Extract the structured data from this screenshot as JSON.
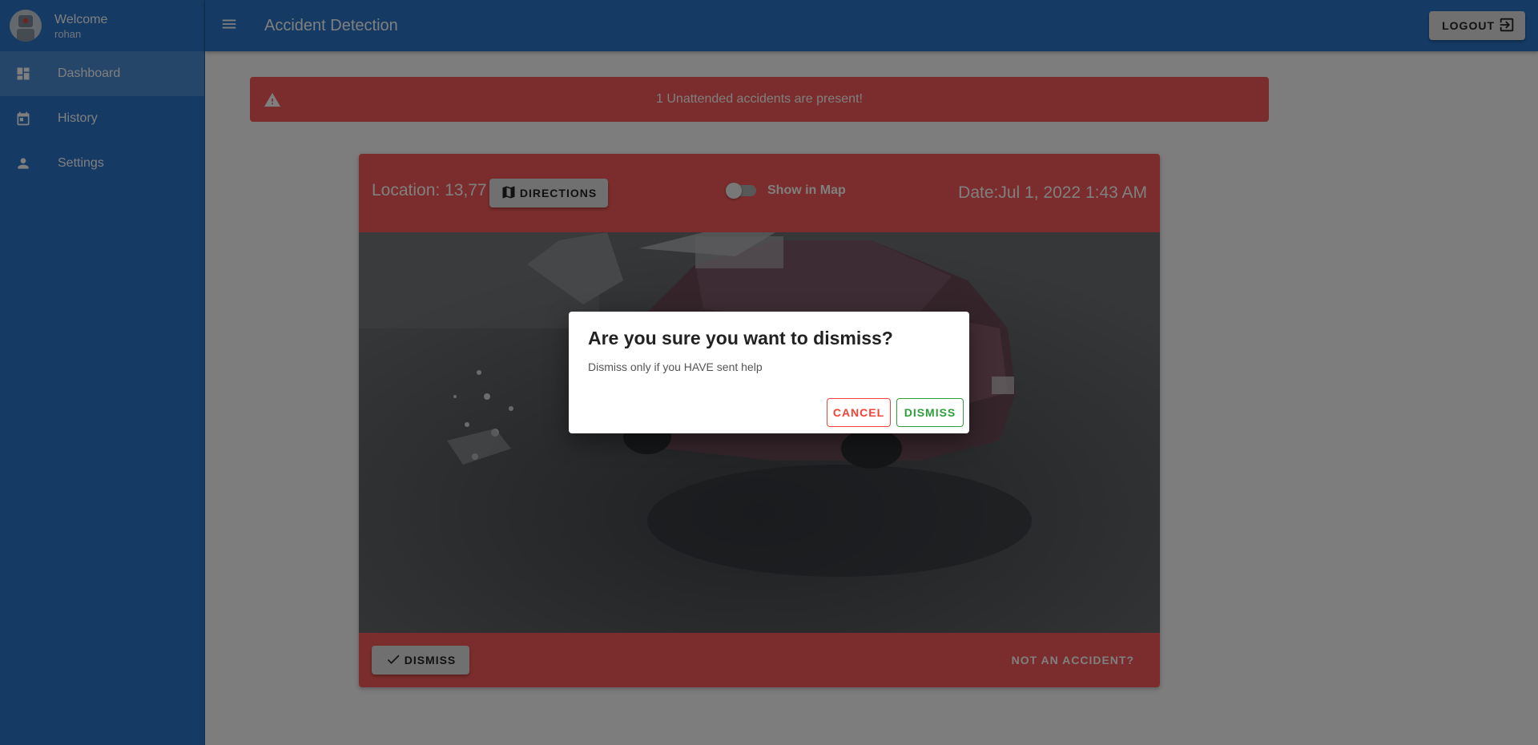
{
  "user": {
    "welcome": "Welcome",
    "name": "rohan"
  },
  "sidebar": {
    "items": [
      {
        "label": "Dashboard",
        "icon": "dashboard-icon",
        "active": true
      },
      {
        "label": "History",
        "icon": "calendar-icon",
        "active": false
      },
      {
        "label": "Settings",
        "icon": "person-icon",
        "active": false
      }
    ]
  },
  "appbar": {
    "title": "Accident Detection",
    "logout_label": "LOGOUT"
  },
  "alert": {
    "text": "1 Unattended accidents are present!",
    "icon": "warning-icon"
  },
  "accident_card": {
    "location": "Location: 13,77",
    "directions_label": "DIRECTIONS",
    "show_in_map_label": "Show in Map",
    "show_in_map_on": false,
    "date": "Date:Jul 1, 2022 1:43 AM",
    "dismiss_label": "DISMISS",
    "not_accident_label": "NOT AN ACCIDENT?"
  },
  "dialog": {
    "title": "Are you sure you want to dismiss?",
    "text": "Dismiss only if you HAVE sent help",
    "cancel_label": "CANCEL",
    "dismiss_label": "DISMISS"
  },
  "colors": {
    "primary": "#2a74c8",
    "danger": "#f55a58",
    "cancel": "#f44336",
    "confirm": "#2e9e3a"
  }
}
